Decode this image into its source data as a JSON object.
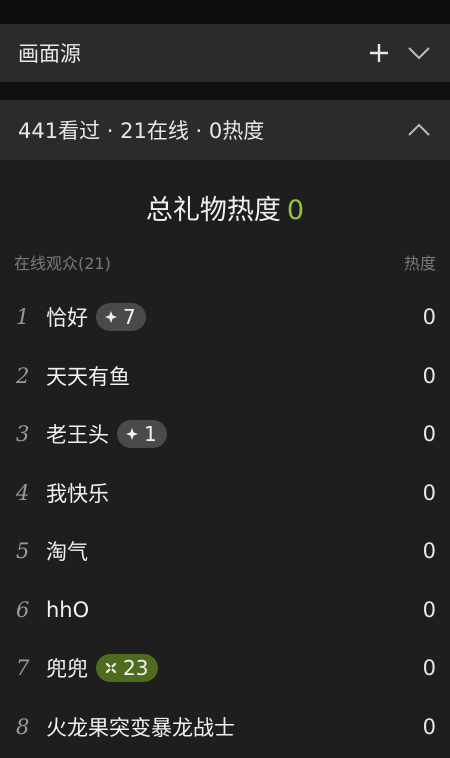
{
  "source_panel": {
    "title": "画面源"
  },
  "stats_panel": {
    "title": "441看过 · 21在线 · 0热度"
  },
  "gift_heat": {
    "label": "总礼物热度",
    "value": "0"
  },
  "columns": {
    "audience": "在线观众(21)",
    "heat": "热度"
  },
  "viewers": [
    {
      "rank": "1",
      "name": "恰好",
      "badge": "7",
      "badge_style": "gray",
      "heat": "0"
    },
    {
      "rank": "2",
      "name": "天天有鱼",
      "badge": null,
      "heat": "0"
    },
    {
      "rank": "3",
      "name": "老王头",
      "badge": "1",
      "badge_style": "gray",
      "heat": "0"
    },
    {
      "rank": "4",
      "name": "我快乐",
      "badge": null,
      "heat": "0"
    },
    {
      "rank": "5",
      "name": "淘气",
      "badge": null,
      "heat": "0"
    },
    {
      "rank": "6",
      "name": "hhO",
      "badge": null,
      "heat": "0"
    },
    {
      "rank": "7",
      "name": "兜兜",
      "badge": "23",
      "badge_style": "green",
      "heat": "0"
    },
    {
      "rank": "8",
      "name": "火龙果突变暴龙战士",
      "badge": null,
      "heat": "0"
    }
  ],
  "colors": {
    "accent_green": "#9ac13b",
    "badge_gray": "#4a4a4b",
    "badge_green": "#4f6b1f"
  }
}
